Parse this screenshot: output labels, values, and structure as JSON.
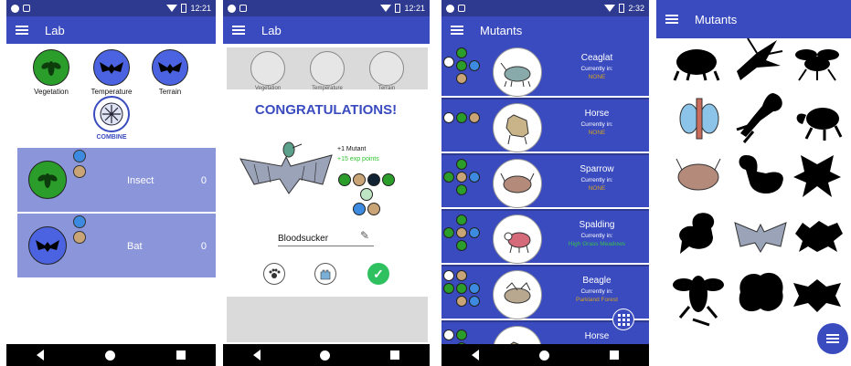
{
  "panel1": {
    "time": "12:21",
    "title": "Lab",
    "categories": [
      "Vegetation",
      "Temperature",
      "Terrain"
    ],
    "combine": "COMBINE",
    "slots": [
      {
        "name": "Insect",
        "count": "0"
      },
      {
        "name": "Bat",
        "count": "0"
      }
    ]
  },
  "panel2": {
    "time": "12:21",
    "title": "Lab",
    "categories": [
      "Vegetation",
      "Temperature",
      "Terrain"
    ],
    "congrats": "CONGRATULATIONS!",
    "plus_mutant": "+1 Mutant",
    "exp": "+15 exp points",
    "name_value": "Bloodsucker"
  },
  "panel3": {
    "time": "2:32",
    "title": "Mutants",
    "currently_in": "Currently in:",
    "rows": [
      {
        "name": "Ceaglat",
        "location": "NONE"
      },
      {
        "name": "Horse",
        "location": "NONE"
      },
      {
        "name": "Sparrow",
        "location": "NONE"
      },
      {
        "name": "Spalding",
        "location": "High Grass Meadows"
      },
      {
        "name": "Beagle",
        "location": "Parkland Forest"
      },
      {
        "name": "Horse",
        "location": ""
      }
    ]
  },
  "panel4": {
    "title": "Mutants"
  },
  "colors": {
    "primary": "#3a4bbf",
    "primary_dark": "#2e3a8f",
    "slot_bg": "#8b95d9",
    "accent_green": "#2fc160",
    "location_yellow": "#d3a21f"
  }
}
